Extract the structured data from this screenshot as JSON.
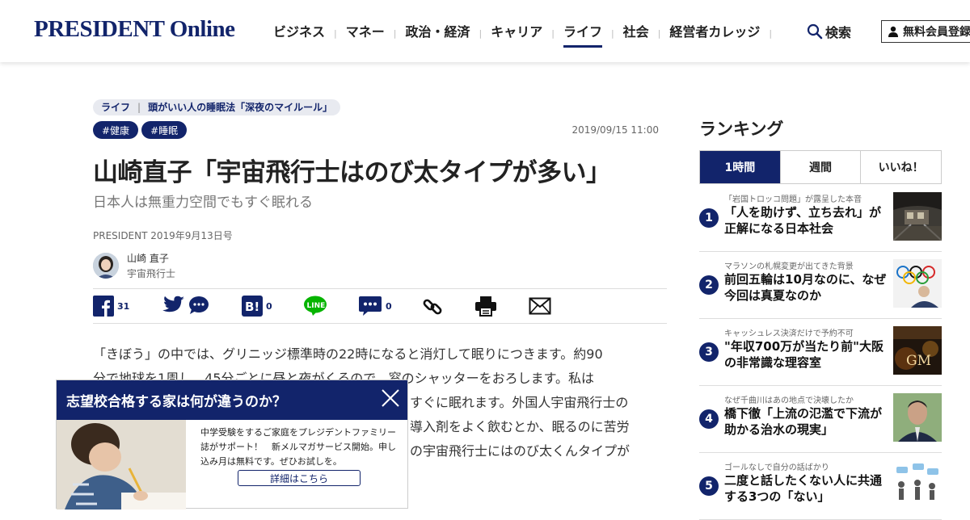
{
  "header": {
    "logo": "PRESIDENT Online",
    "nav": [
      "ビジネス",
      "マネー",
      "政治・経済",
      "キャリア",
      "ライフ",
      "社会",
      "経営者カレッジ"
    ],
    "active_nav": "ライフ",
    "search_label": "検索",
    "register_label": "無料会員登録"
  },
  "article": {
    "breadcrumb": {
      "category": "ライフ",
      "series": "頭がいい人の睡眠法「深夜のマイルール」"
    },
    "tags": [
      "#健康",
      "#睡眠"
    ],
    "date": "2019/09/15 11:00",
    "title": "山崎直子「宇宙飛行士はのび太タイプが多い」",
    "subtitle": "日本人は無重力空間でもすぐ眠れる",
    "source": "PRESIDENT 2019年9月13日号",
    "author": {
      "name": "山崎 直子",
      "role": "宇宙飛行士"
    },
    "share": {
      "facebook_count": "31",
      "hatena_count": "0",
      "comment_count": "0"
    },
    "body": [
      "「きぼう」の中では、グリニッジ標準時の22時になると消灯して眠りにつきます。約90",
      "分で地球を1周し、45分ごとに昼と夜がくるので、窓のシャッターをおろします。私は",
      "すぐに眠れます。外国人宇宙飛行士の",
      "導入剤をよく飲むとか、眠るのに苦労",
      "の宇宙飛行士にはのび太くんタイプが"
    ]
  },
  "ranking": {
    "title": "ランキング",
    "tabs": [
      "1時間",
      "週間",
      "いいね！"
    ],
    "active_tab": "1時間",
    "items": [
      {
        "rank": "1",
        "kicker": "「岩国トロッコ問題」が露呈した本音",
        "headline": "「人を助けず、立ち去れ」が正解になる日本社会"
      },
      {
        "rank": "2",
        "kicker": "マラソンの札幌変更が出てきた背景",
        "headline": "前回五輪は10月なのに、なぜ今回は真夏なのか"
      },
      {
        "rank": "3",
        "kicker": "キャッシュレス決済だけで予約不可",
        "headline": "\"年収700万が当たり前\"大阪の非常識な理容室"
      },
      {
        "rank": "4",
        "kicker": "なぜ千曲川はあの地点で決壊したか",
        "headline": "橋下徹「上流の氾濫で下流が助かる治水の現実」"
      },
      {
        "rank": "5",
        "kicker": "ゴールなしで自分の話ばかり",
        "headline": "二度と話したくない人に共通する3つの「ない」"
      }
    ]
  },
  "promo": {
    "title": "志望校合格する家は何が違うのか？",
    "text": "中学受験をするご家庭をプレジデントファミリー誌がサポート！　新メルマガサービス開始。申し込み月は無料です。ぜひお試しを。",
    "button": "詳細はこちら"
  },
  "colors": {
    "brand_navy": "#12246b"
  }
}
